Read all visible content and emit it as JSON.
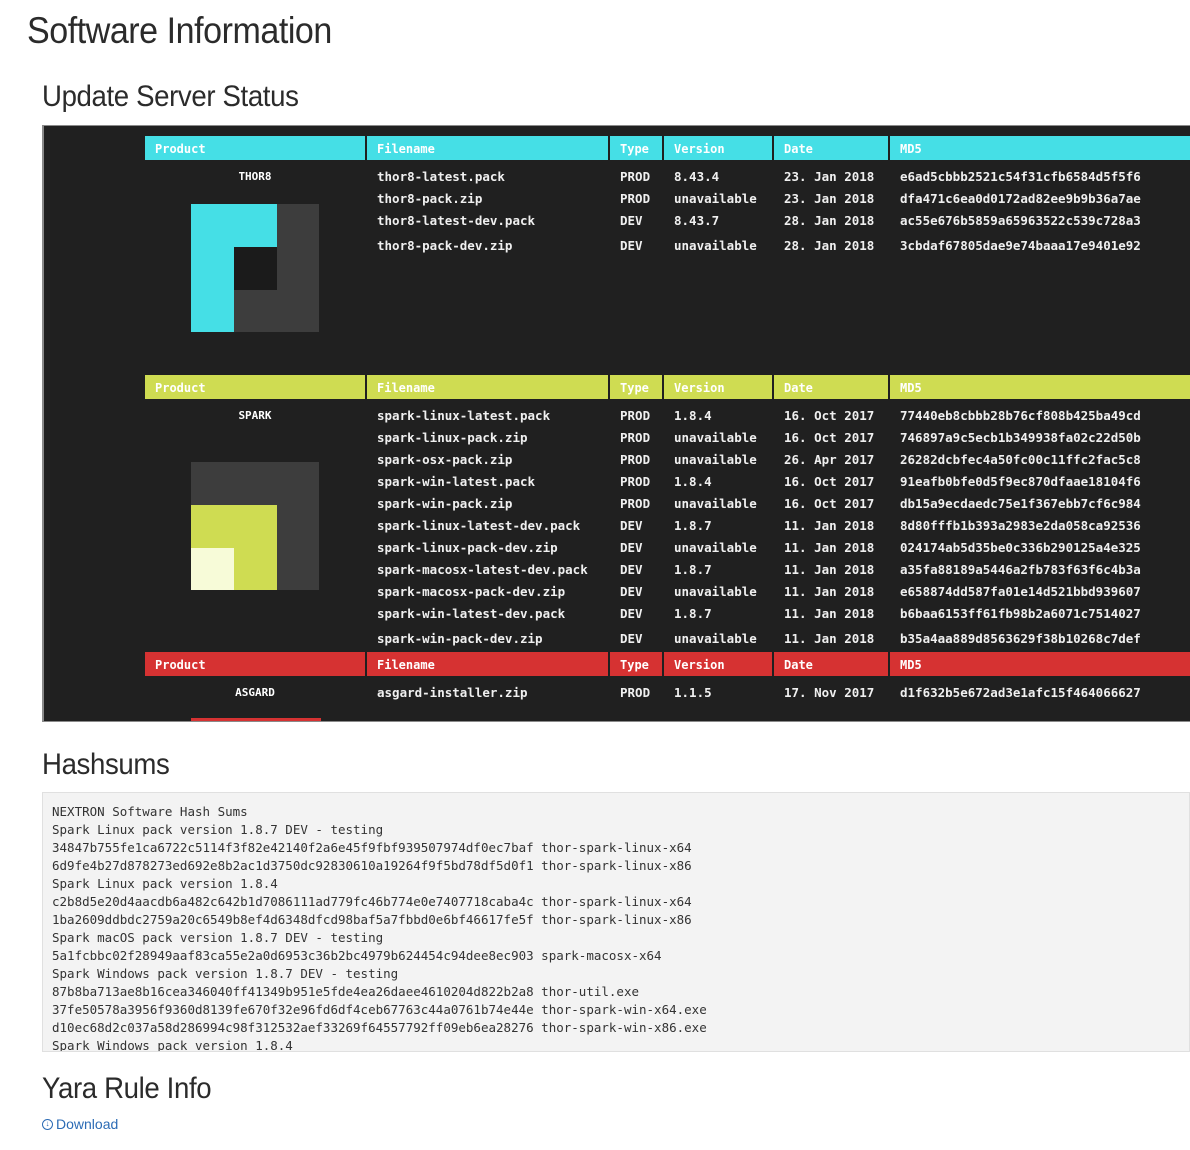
{
  "page_title": "Software Information",
  "sections": {
    "update_status": "Update Server Status",
    "hashsums": "Hashsums",
    "yara": "Yara Rule Info"
  },
  "table_headers": [
    "Product",
    "Filename",
    "Type",
    "Version",
    "Date",
    "MD5"
  ],
  "colors": {
    "thor8": "#45dfe6",
    "spark": "#cfdc52",
    "asgard": "#d63232",
    "logo_dark": "#3d3d3d",
    "logo_black": "#1b1b1b",
    "spark_light": "#f7fbd8",
    "link": "#2b6bb5"
  },
  "products": [
    {
      "name": "THOR8",
      "color": "#45dfe6",
      "logo_icon": "thor-logo-icon",
      "files": [
        [
          "thor8-latest.pack",
          "PROD",
          "8.43.4",
          "23. Jan 2018",
          "e6ad5cbbb2521c54f31cfb6584d5f5f6"
        ],
        [
          "thor8-pack.zip",
          "PROD",
          "unavailable",
          "23. Jan 2018",
          "dfa471c6ea0d0172ad82ee9b9b36a7ae"
        ],
        [
          "thor8-latest-dev.pack",
          "DEV",
          "8.43.7",
          "28. Jan 2018",
          "ac55e676b5859a65963522c539c728a3"
        ],
        [
          "thor8-pack-dev.zip",
          "DEV",
          "unavailable",
          "28. Jan 2018",
          "3cbdaf67805dae9e74baaa17e9401e92"
        ]
      ]
    },
    {
      "name": "SPARK",
      "color": "#cfdc52",
      "logo_icon": "spark-logo-icon",
      "files": [
        [
          "spark-linux-latest.pack",
          "PROD",
          "1.8.4",
          "16. Oct 2017",
          "77440eb8cbbb28b76cf808b425ba49cd"
        ],
        [
          "spark-linux-pack.zip",
          "PROD",
          "unavailable",
          "16. Oct 2017",
          "746897a9c5ecb1b349938fa02c22d50b"
        ],
        [
          "spark-osx-pack.zip",
          "PROD",
          "unavailable",
          "26. Apr 2017",
          "26282dcbfec4a50fc00c11ffc2fac5c8"
        ],
        [
          "spark-win-latest.pack",
          "PROD",
          "1.8.4",
          "16. Oct 2017",
          "91eafb0bfe0d5f9ec870dfaae18104f6"
        ],
        [
          "spark-win-pack.zip",
          "PROD",
          "unavailable",
          "16. Oct 2017",
          "db15a9ecdaedc75e1f367ebb7cf6c984"
        ],
        [
          "spark-linux-latest-dev.pack",
          "DEV",
          "1.8.7",
          "11. Jan 2018",
          "8d80fffb1b393a2983e2da058ca92536"
        ],
        [
          "spark-linux-pack-dev.zip",
          "DEV",
          "unavailable",
          "11. Jan 2018",
          "024174ab5d35be0c336b290125a4e325"
        ],
        [
          "spark-macosx-latest-dev.pack",
          "DEV",
          "1.8.7",
          "11. Jan 2018",
          "a35fa88189a5446a2fb783f63f6c4b3a"
        ],
        [
          "spark-macosx-pack-dev.zip",
          "DEV",
          "unavailable",
          "11. Jan 2018",
          "e658874dd587fa01e14d521bbd939607"
        ],
        [
          "spark-win-latest-dev.pack",
          "DEV",
          "1.8.7",
          "11. Jan 2018",
          "b6baa6153ff61fb98b2a6071c7514027"
        ],
        [
          "spark-win-pack-dev.zip",
          "DEV",
          "unavailable",
          "11. Jan 2018",
          "b35a4aa889d8563629f38b10268c7def"
        ]
      ]
    },
    {
      "name": "ASGARD",
      "color": "#d63232",
      "logo_icon": "asgard-logo-icon",
      "files": [
        [
          "asgard-installer.zip",
          "PROD",
          "1.1.5",
          "17. Nov 2017",
          "d1f632b5e672ad3e1afc15f464066627"
        ]
      ]
    }
  ],
  "hashsums_text": [
    "NEXTRON Software Hash Sums",
    "Spark Linux pack version 1.8.7 DEV - testing",
    "34847b755fe1ca6722c5114f3f82e42140f2a6e45f9fbf939507974df0ec7baf thor-spark-linux-x64",
    "6d9fe4b27d878273ed692e8b2ac1d3750dc92830610a19264f9f5bd78df5d0f1 thor-spark-linux-x86",
    "Spark Linux pack version 1.8.4",
    "c2b8d5e20d4aacdb6a482c642b1d7086111ad779fc46b774e0e7407718caba4c thor-spark-linux-x64",
    "1ba2609ddbdc2759a20c6549b8ef4d6348dfcd98baf5a7fbbd0e6bf46617fe5f thor-spark-linux-x86",
    "Spark macOS pack version 1.8.7 DEV - testing",
    "5a1fcbbc02f28949aaf83ca55e2a0d6953c36b2bc4979b624454c94dee8ec903 spark-macosx-x64",
    "Spark Windows pack version 1.8.7 DEV - testing",
    "87b8ba713ae8b16cea346040ff41349b951e5fde4ea26daee4610204d822b2a8 thor-util.exe",
    "37fe50578a3956f9360d8139fe670f32e96fd6df4ceb67763c44a0761b74e44e thor-spark-win-x64.exe",
    "d10ec68d2c037a58d286994c98f312532aef33269f64557792ff09eb6ea28276 thor-spark-win-x86.exe",
    "Spark Windows pack version 1.8.4"
  ],
  "yara": {
    "download_label": "Download",
    "download_icon": "download-circle-icon"
  }
}
